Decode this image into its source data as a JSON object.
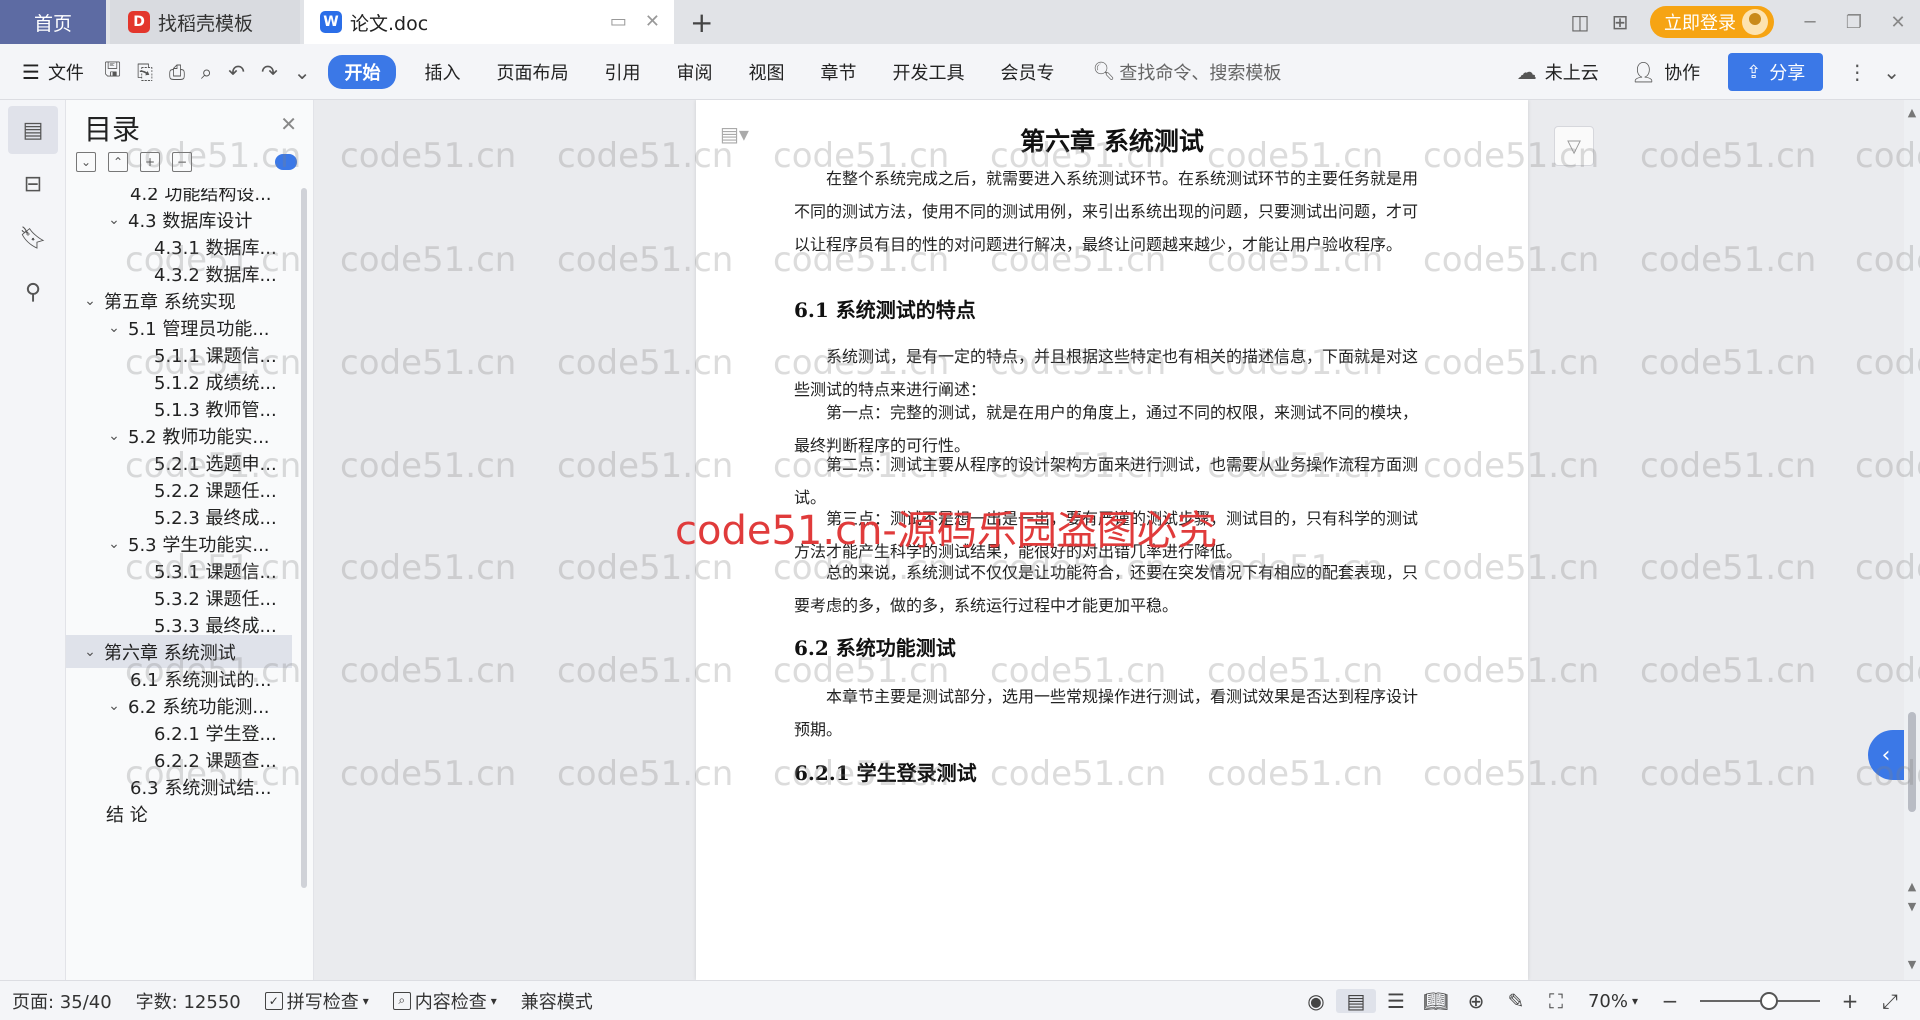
{
  "tabs": {
    "home": "首页",
    "template": "找稻壳模板",
    "doc": "论文.doc"
  },
  "titlebar": {
    "login": "立即登录"
  },
  "ribbon": {
    "file": "文件",
    "tabs": [
      "开始",
      "插入",
      "页面布局",
      "引用",
      "审阅",
      "视图",
      "章节",
      "开发工具",
      "会员专"
    ],
    "search_placeholder": "查找命令、搜索模板",
    "cloud": "未上云",
    "collab": "协作",
    "share": "分享"
  },
  "toc": {
    "title": "目录",
    "items": [
      {
        "label": "4.2 功能结构设...",
        "level": 2,
        "chev": false
      },
      {
        "label": "4.3 数据库设计",
        "level": 2,
        "chev": true
      },
      {
        "label": "4.3.1 数据库...",
        "level": 3,
        "chev": false
      },
      {
        "label": "4.3.2 数据库...",
        "level": 3,
        "chev": false
      },
      {
        "label": "第五章 系统实现",
        "level": 1,
        "chev": true
      },
      {
        "label": "5.1 管理员功能...",
        "level": 2,
        "chev": true
      },
      {
        "label": "5.1.1 课题信...",
        "level": 3,
        "chev": false
      },
      {
        "label": "5.1.2 成绩统...",
        "level": 3,
        "chev": false
      },
      {
        "label": "5.1.3 教师管...",
        "level": 3,
        "chev": false
      },
      {
        "label": "5.2 教师功能实...",
        "level": 2,
        "chev": true
      },
      {
        "label": "5.2.1 选题申...",
        "level": 3,
        "chev": false
      },
      {
        "label": "5.2.2 课题任...",
        "level": 3,
        "chev": false
      },
      {
        "label": "5.2.3 最终成...",
        "level": 3,
        "chev": false
      },
      {
        "label": "5.3 学生功能实...",
        "level": 2,
        "chev": true
      },
      {
        "label": "5.3.1 课题信...",
        "level": 3,
        "chev": false
      },
      {
        "label": "5.3.2 课题任...",
        "level": 3,
        "chev": false
      },
      {
        "label": "5.3.3 最终成...",
        "level": 3,
        "chev": false
      },
      {
        "label": "第六章 系统测试",
        "level": 1,
        "chev": true,
        "selected": true
      },
      {
        "label": "6.1 系统测试的...",
        "level": 2,
        "chev": false
      },
      {
        "label": "6.2 系统功能测...",
        "level": 2,
        "chev": true
      },
      {
        "label": "6.2.1 学生登...",
        "level": 3,
        "chev": false
      },
      {
        "label": "6.2.2 课题查...",
        "level": 3,
        "chev": false
      },
      {
        "label": "6.3 系统测试结...",
        "level": 2,
        "chev": false
      },
      {
        "label": "结 论",
        "level": 1,
        "chev": false
      }
    ]
  },
  "document": {
    "chapter_title": "第六章 系统测试",
    "intro": "在整个系统完成之后，就需要进入系统测试环节。在系统测试环节的主要任务就是用不同的测试方法，使用不同的测试用例，来引出系统出现的问题，只要测试出问题，才可以让程序员有目的性的对问题进行解决，最终让问题越来越少，才能让用户验收程序。",
    "h_61": "6.1 系统测试的特点",
    "p_61_1": "系统测试，是有一定的特点，并且根据这些特定也有相关的描述信息，下面就是对这些测试的特点来进行阐述：",
    "p_61_2": "第一点：完整的测试，就是在用户的角度上，通过不同的权限，来测试不同的模块，最终判断程序的可行性。",
    "p_61_3": "第二点：测试主要从程序的设计架构方面来进行测试，也需要从业务操作流程方面测试。",
    "p_61_4": "第三点：测试不是想一出是一出，要有严谨的测试步骤，测试目的，只有科学的测试方法才能产生科学的测试结果，能很好的对出错几率进行降低。",
    "p_61_5": "总的来说，系统测试不仅仅是让功能符合，还要在突发情况下有相应的配套表现，只要考虑的多，做的多，系统运行过程中才能更加平稳。",
    "h_62": "6.2 系统功能测试",
    "p_62": "本章节主要是测试部分，选用一些常规操作进行测试，看测试效果是否达到程序设计预期。",
    "h_621": "6.2.1 学生登录测试"
  },
  "watermark": {
    "text": "code51.cn",
    "center": "code51.cn-源码乐园盗图必究"
  },
  "status": {
    "page": "页面: 35/40",
    "words": "字数: 12550",
    "spell": "拼写检查",
    "content": "内容检查",
    "compat": "兼容模式",
    "zoom": "70%"
  }
}
